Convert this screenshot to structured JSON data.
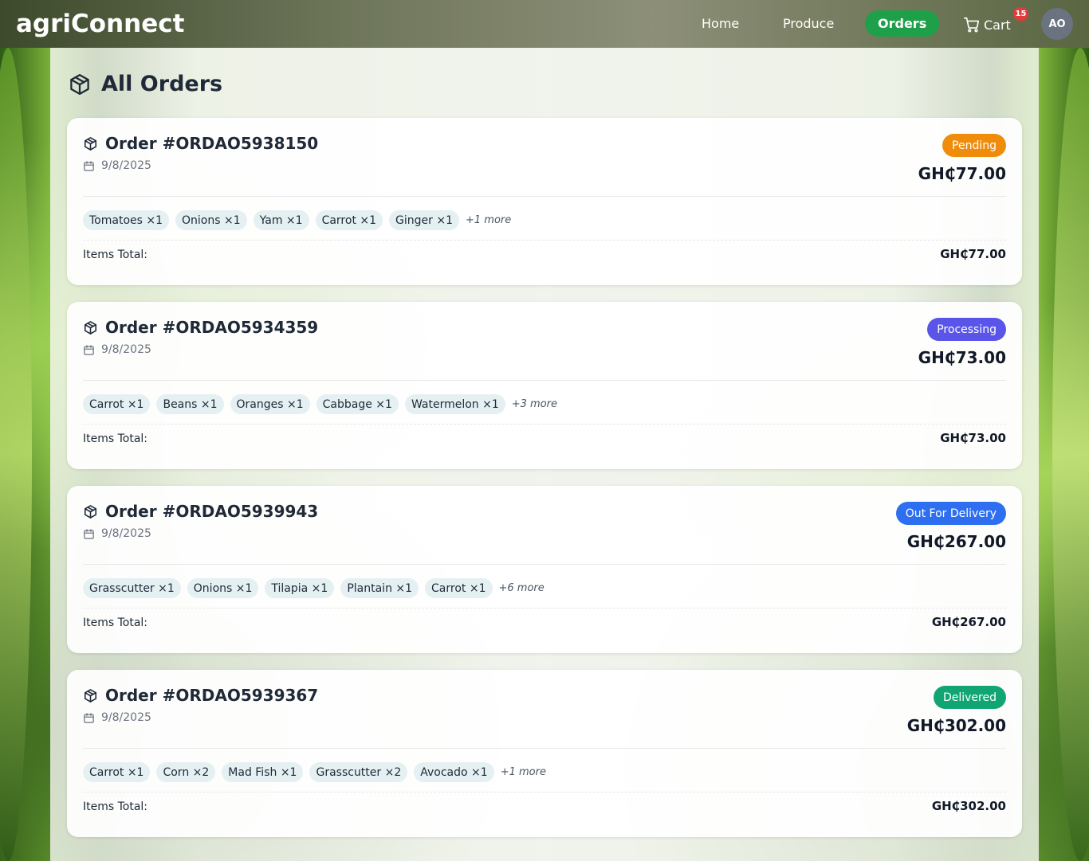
{
  "brand": "agriConnect",
  "nav": {
    "home": "Home",
    "produce": "Produce",
    "orders": "Orders",
    "cart": "Cart",
    "cart_count": "15",
    "avatar_initials": "AO"
  },
  "page": {
    "title": "All Orders"
  },
  "colors": {
    "accent_green": "#1ea04a",
    "pending": "#f08c0c",
    "processing": "#5a55e8",
    "out_for_delivery": "#2d6ff0",
    "delivered": "#12a574"
  },
  "icons": [
    "box-icon",
    "calendar-icon",
    "cart-icon"
  ],
  "orders": [
    {
      "id": "Order #ORDAO5938150",
      "date": "9/8/2025",
      "status": "Pending",
      "total": "GH₵77.00",
      "items": [
        "Tomatoes ×1",
        "Onions ×1",
        "Yam ×1",
        "Carrot ×1",
        "Ginger ×1"
      ],
      "more": "+1 more",
      "items_total_label": "Items Total:",
      "items_total": "GH₵77.00"
    },
    {
      "id": "Order #ORDAO5934359",
      "date": "9/8/2025",
      "status": "Processing",
      "total": "GH₵73.00",
      "items": [
        "Carrot ×1",
        "Beans ×1",
        "Oranges ×1",
        "Cabbage ×1",
        "Watermelon ×1"
      ],
      "more": "+3 more",
      "items_total_label": "Items Total:",
      "items_total": "GH₵73.00"
    },
    {
      "id": "Order #ORDAO5939943",
      "date": "9/8/2025",
      "status": "Out For Delivery",
      "total": "GH₵267.00",
      "items": [
        "Grasscutter ×1",
        "Onions ×1",
        "Tilapia ×1",
        "Plantain ×1",
        "Carrot ×1"
      ],
      "more": "+6 more",
      "items_total_label": "Items Total:",
      "items_total": "GH₵267.00"
    },
    {
      "id": "Order #ORDAO5939367",
      "date": "9/8/2025",
      "status": "Delivered",
      "total": "GH₵302.00",
      "items": [
        "Carrot ×1",
        "Corn ×2",
        "Mad Fish ×1",
        "Grasscutter ×2",
        "Avocado ×1"
      ],
      "more": "+1 more",
      "items_total_label": "Items Total:",
      "items_total": "GH₵302.00"
    }
  ]
}
